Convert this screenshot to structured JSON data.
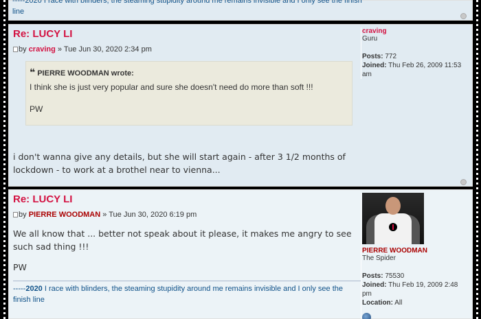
{
  "top_post": {
    "signature": "-----2020 I race with blinders, the steaming stupidity around me remains invisible and I only see the finish line"
  },
  "posts": [
    {
      "title": "Re: LUCY LI",
      "meta_prefix": "by",
      "author": "craving",
      "date": "» Tue Jun 30, 2020 2:34 pm",
      "quote": {
        "author_line": "PIERRE WOODMAN wrote:",
        "text": "I think she is just very popular and sure she doesn't need do more than soft !!!",
        "signoff": "PW"
      },
      "content": "i don't wanna give any details, but she will start again - after 3 1/2 months of lockdown - to work at a brothel near to vienna...",
      "profile": {
        "name": "craving",
        "rank": "Guru",
        "posts_label": "Posts:",
        "posts": "772",
        "joined_label": "Joined:",
        "joined": "Thu Feb 26, 2009 11:53 am"
      }
    },
    {
      "title": "Re: LUCY LI",
      "meta_prefix": "by",
      "author": "PIERRE WOODMAN",
      "date": "» Tue Jun 30, 2020 6:19 pm",
      "content": "We all know that ... better not speak about it please, it makes me angry to see such sad thing !!!",
      "signoff": "PW",
      "signature_prefix": "-----",
      "signature_year": "2020",
      "signature_text": " I race with blinders, the steaming stupidity around me remains invisible and I only see the finish line",
      "profile": {
        "name": "PIERRE WOODMAN",
        "rank": "The Spider",
        "posts_label": "Posts:",
        "posts": "75530",
        "joined_label": "Joined:",
        "joined": "Thu Feb 19, 2009 2:48 pm",
        "location_label": "Location:",
        "location": "All"
      }
    }
  ],
  "colors": {
    "title": "#d31141",
    "link": "#105289",
    "post_bg_1": "#e1ebf2",
    "post_bg_2": "#ecf3f7",
    "quote_bg": "#ebeadd"
  },
  "icons": [
    "post-icon",
    "back-to-top-icon",
    "quote-mark-icon",
    "website-globe-icon"
  ]
}
